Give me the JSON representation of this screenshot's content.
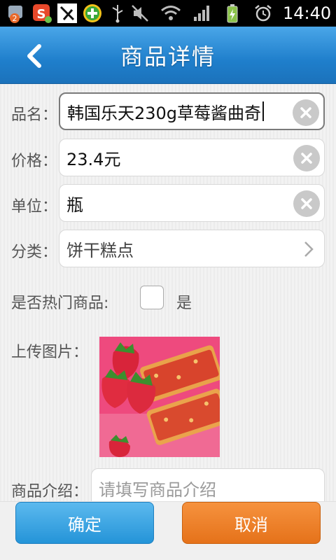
{
  "status_bar": {
    "time": "14:40",
    "notification_count": "2",
    "icons": [
      "android-badge-icon",
      "sogou-icon",
      "tool-icon",
      "plus-circle-icon",
      "usb-icon",
      "mute-icon",
      "wifi-icon",
      "signal-icon",
      "battery-icon",
      "alarm-icon"
    ]
  },
  "header": {
    "title": "商品详情",
    "back_icon": "back-arrow-icon"
  },
  "form": {
    "name": {
      "label": "品名：",
      "value": "韩国乐天230g草莓酱曲奇"
    },
    "price": {
      "label": "价格：",
      "value": "23.4元"
    },
    "unit": {
      "label": "单位：",
      "value": "瓶"
    },
    "category": {
      "label": "分类：",
      "value": "饼干糕点"
    },
    "hot": {
      "label": "是否热门商品:",
      "option": "是",
      "checked": false
    },
    "image": {
      "label": "上传图片：",
      "alt": "strawberry-jam-cookies"
    },
    "intro": {
      "label": "商品介绍：",
      "placeholder": "请填写商品介绍"
    }
  },
  "actions": {
    "confirm": "确定",
    "cancel": "取消"
  },
  "colors": {
    "header": "#1f7fcc",
    "confirm": "#2494d8",
    "cancel": "#e5721a"
  }
}
